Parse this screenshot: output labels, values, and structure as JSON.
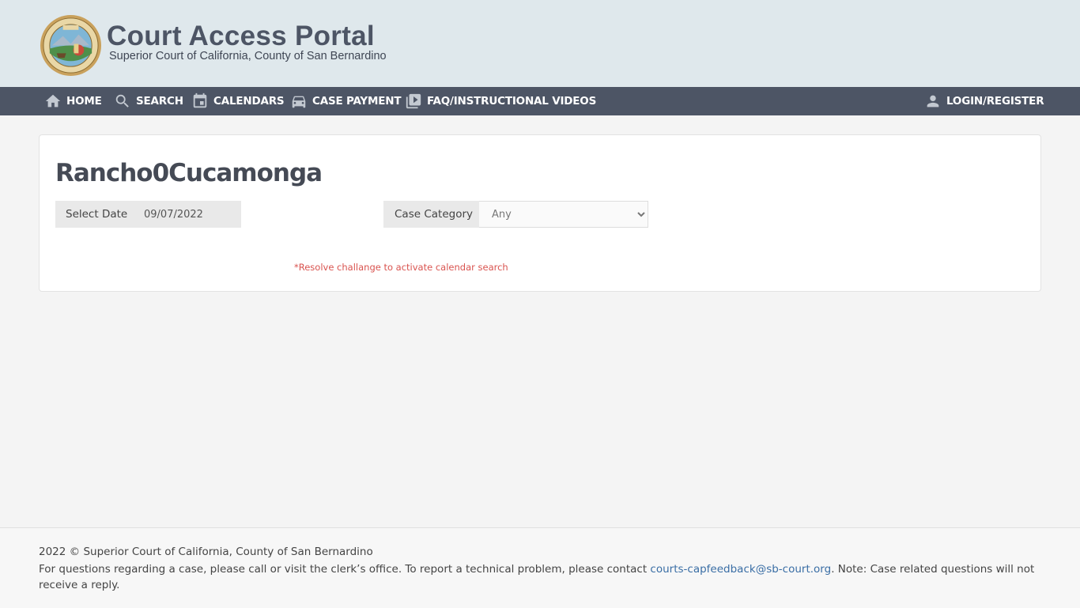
{
  "header": {
    "title": "Court Access Portal",
    "subtitle": "Superior Court of California, County of San Bernardino",
    "seal_alt": "Superior Court of California County of San Bernardino seal"
  },
  "nav": {
    "items": [
      {
        "label": "HOME",
        "icon": "home-icon"
      },
      {
        "label": "SEARCH",
        "icon": "search-icon"
      },
      {
        "label": "CALENDARS",
        "icon": "calendar-icon"
      },
      {
        "label": "CASE PAYMENT",
        "icon": "car-icon"
      },
      {
        "label": "FAQ/INSTRUCTIONAL VIDEOS",
        "icon": "video-library-icon"
      }
    ],
    "login": {
      "label": "LOGIN/REGISTER",
      "icon": "person-icon"
    }
  },
  "main": {
    "location_title": "Rancho0Cucamonga",
    "select_date_label": "Select Date",
    "date_value": "09/07/2022",
    "case_category_label": "Case Category",
    "case_category_value": "Any",
    "warning": "*Resolve challange to activate calendar search"
  },
  "footer": {
    "copyright": "2022 © Superior Court of California, County of San Bernardino",
    "notice_before": "For questions regarding a case, please call or visit the clerk’s office. To report a technical problem, please contact ",
    "email": "courts-capfeedback@sb-court.org",
    "notice_after": ". Note: Case related questions will not receive a reply."
  },
  "colors": {
    "header_bg": "#dfe8ec",
    "navbar_bg": "#4d5565",
    "brand_text": "#4d5565",
    "warning": "#d9534f",
    "link": "#3a6ea5"
  }
}
